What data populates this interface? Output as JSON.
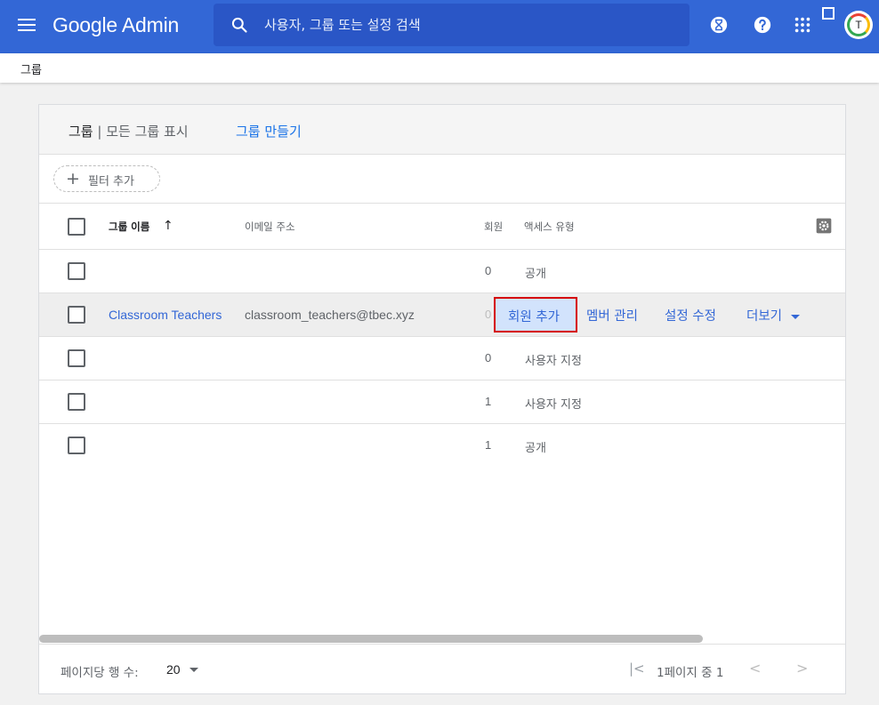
{
  "topbar": {
    "brand": "Google Admin",
    "search_placeholder": "사용자, 그룹 또는 설정 검색",
    "icons": [
      "menu-icon",
      "search-icon",
      "hourglass-icon",
      "help-icon",
      "apps-grid-icon",
      "square-icon"
    ],
    "avatar_letter": "T",
    "color": "#3367d6"
  },
  "breadcrumb": {
    "current": "그룹"
  },
  "card": {
    "title": "그룹",
    "separator": " | ",
    "view": "모든 그룹 표시",
    "create": "그룹 만들기",
    "filter": "필터 추가"
  },
  "columns": {
    "name": "그룹 이름",
    "email": "이메일 주소",
    "members": "회원",
    "access": "액세스 유형"
  },
  "rows": [
    {
      "name": "",
      "email": "",
      "members": "0",
      "access": "공개"
    },
    {
      "name": "Classroom Teachers",
      "email": "classroom_teachers@tbec.xyz",
      "members": "0",
      "access": ""
    },
    {
      "name": "",
      "email": "",
      "members": "0",
      "access": "사용자 지정"
    },
    {
      "name": "",
      "email": "",
      "members": "1",
      "access": "사용자 지정"
    },
    {
      "name": "",
      "email": "",
      "members": "1",
      "access": "공개"
    }
  ],
  "row_actions": {
    "add_members": "회원 추가",
    "manage_members": "멤버 관리",
    "edit_settings": "설정 수정",
    "more": "더보기"
  },
  "footer": {
    "rows_per_page_label": "페이지당 행 수:",
    "rows_per_page_value": "20",
    "page_info": "1페이지 중 1",
    "first_symbol": "|<",
    "prev_symbol": "<",
    "next_symbol": ">"
  }
}
